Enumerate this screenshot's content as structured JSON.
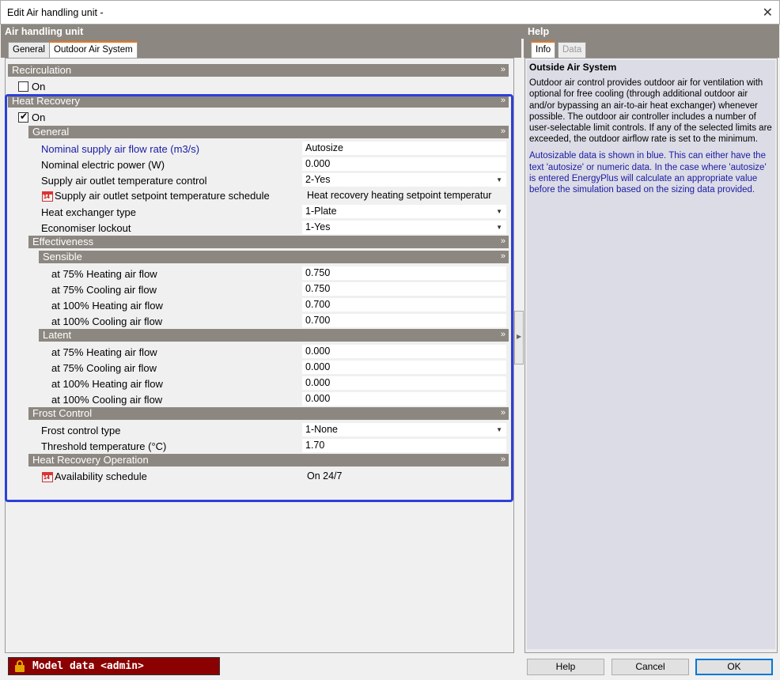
{
  "window": {
    "title": "Edit Air handling unit -",
    "close_glyph": "✕"
  },
  "left_panel": {
    "title": "Air handling unit",
    "tabs": [
      {
        "label": "General"
      },
      {
        "label": "Outdoor Air System"
      }
    ]
  },
  "recirculation": {
    "title": "Recirculation",
    "on_label": "On",
    "checked": false
  },
  "heat_recovery": {
    "title": "Heat Recovery",
    "on_label": "On",
    "checked": true,
    "general": {
      "title": "General",
      "rows": [
        {
          "label": "Nominal supply air flow rate (m3/s)",
          "value": "Autosize"
        },
        {
          "label": "Nominal electric power (W)",
          "value": "0.000"
        },
        {
          "label": "Supply air outlet temperature control",
          "value": "2-Yes"
        },
        {
          "label": "Supply air outlet setpoint temperature schedule",
          "value": "Heat recovery heating setpoint temperatur"
        },
        {
          "label": "Heat exchanger type",
          "value": "1-Plate"
        },
        {
          "label": "Economiser lockout",
          "value": "1-Yes"
        }
      ]
    },
    "effectiveness": {
      "title": "Effectiveness",
      "sensible": {
        "title": "Sensible",
        "rows": [
          {
            "label": "at 75% Heating air flow",
            "value": "0.750"
          },
          {
            "label": "at 75% Cooling air flow",
            "value": "0.750"
          },
          {
            "label": "at 100% Heating air flow",
            "value": "0.700"
          },
          {
            "label": "at 100% Cooling air flow",
            "value": "0.700"
          }
        ]
      },
      "latent": {
        "title": "Latent",
        "rows": [
          {
            "label": "at 75% Heating air flow",
            "value": "0.000"
          },
          {
            "label": "at 75% Cooling air flow",
            "value": "0.000"
          },
          {
            "label": "at 100% Heating air flow",
            "value": "0.000"
          },
          {
            "label": "at 100% Cooling air flow",
            "value": "0.000"
          }
        ]
      }
    },
    "frost_control": {
      "title": "Frost Control",
      "rows": [
        {
          "label": "Frost control type",
          "value": "1-None"
        },
        {
          "label": "Threshold temperature (°C)",
          "value": "1.70"
        }
      ]
    },
    "operation": {
      "title": "Heat Recovery Operation",
      "rows": [
        {
          "label": "Availability schedule",
          "value": "On 24/7"
        }
      ]
    }
  },
  "help_panel": {
    "title": "Help",
    "tabs": [
      {
        "label": "Info"
      },
      {
        "label": "Data"
      }
    ],
    "heading": "Outside Air System",
    "paragraph1": "Outdoor air control provides outdoor air for ventilation with optional for free cooling (through additional outdoor air and/or bypassing an air-to-air heat exchanger) whenever possible. The outdoor air controller includes a number of user-selectable limit controls. If any of the selected limits are exceeded, the outdoor airflow rate is set to the minimum.",
    "paragraph2": "Autosizable data is shown in blue. This can either have the text 'autosize' or numeric data. In the case where 'autosize' is entered EnergyPlus will calculate an appropriate value before the simulation based on the sizing data provided."
  },
  "status_bar": {
    "label": "Model data <admin>"
  },
  "buttons": {
    "help": "Help",
    "cancel": "Cancel",
    "ok": "OK"
  },
  "glyphs": {
    "collapse": "»",
    "dropdown": "▼",
    "calendar_day": "14"
  },
  "colors": {
    "section_bar": "#8c8780",
    "highlight": "#2e3fd9",
    "status_bar": "#8b0000",
    "autosize_text": "#1a1aa6",
    "active_tab_accent": "#e87722"
  }
}
